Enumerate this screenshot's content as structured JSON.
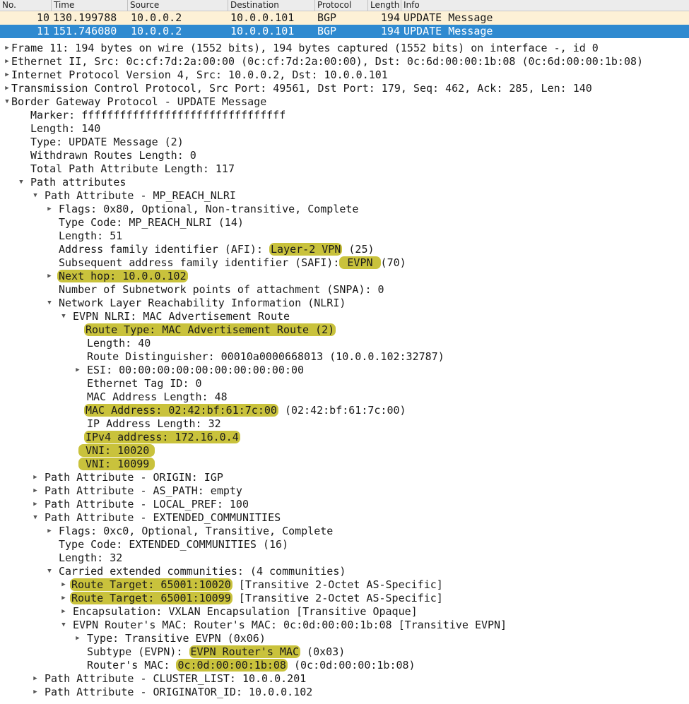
{
  "columns": {
    "no": "No.",
    "time": "Time",
    "source": "Source",
    "destination": "Destination",
    "protocol": "Protocol",
    "length": "Length",
    "info": "Info"
  },
  "packets": [
    {
      "no": "10",
      "time": "130.199788",
      "source": "10.0.0.2",
      "destination": "10.0.0.101",
      "protocol": "BGP",
      "length": "194",
      "info": "UPDATE Message"
    },
    {
      "no": "11",
      "time": "151.746080",
      "source": "10.0.0.2",
      "destination": "10.0.0.101",
      "protocol": "BGP",
      "length": "194",
      "info": "UPDATE Message"
    }
  ],
  "tree": {
    "frame": "Frame 11: 194 bytes on wire (1552 bits), 194 bytes captured (1552 bits) on interface -, id 0",
    "ethernet": "Ethernet II, Src: 0c:cf:7d:2a:00:00 (0c:cf:7d:2a:00:00), Dst: 0c:6d:00:00:1b:08 (0c:6d:00:00:1b:08)",
    "ipv4": "Internet Protocol Version 4, Src: 10.0.0.2, Dst: 10.0.0.101",
    "tcp": "Transmission Control Protocol, Src Port: 49561, Dst Port: 179, Seq: 462, Ack: 285, Len: 140",
    "bgp": "Border Gateway Protocol - UPDATE Message",
    "marker": "Marker: ffffffffffffffffffffffffffffffff",
    "length": "Length: 140",
    "type": "Type: UPDATE Message (2)",
    "withdrawn": "Withdrawn Routes Length: 0",
    "total_pal": "Total Path Attribute Length: 117",
    "path_attrs": "Path attributes",
    "mp_reach": "Path Attribute - MP_REACH_NLRI",
    "mp_flags": "Flags: 0x80, Optional, Non-transitive, Complete",
    "mp_type_code": "Type Code: MP_REACH_NLRI (14)",
    "mp_length": "Length: 51",
    "afi_prefix": "Address family identifier (AFI): ",
    "afi_hl": "Layer-2 VPN",
    "afi_suffix": " (25)",
    "safi_prefix": "Subsequent address family identifier (SAFI):",
    "safi_hl": " EVPN ",
    "safi_suffix": "(70)",
    "next_hop": "Next hop: 10.0.0.102",
    "snpa": "Number of Subnetwork points of attachment (SNPA): 0",
    "nlri": "Network Layer Reachability Information (NLRI)",
    "evpn_nlri": "EVPN NLRI: MAC Advertisement Route",
    "route_type": "Route Type: MAC Advertisement Route (2)",
    "evpn_length": "Length: 40",
    "rd": "Route Distinguisher: 00010a0000668013 (10.0.0.102:32787)",
    "esi": "ESI: 00:00:00:00:00:00:00:00:00:00",
    "eth_tag": "Ethernet Tag ID: 0",
    "mac_len": "MAC Address Length: 48",
    "mac_addr_hl": "MAC Address: 02:42:bf:61:7c:00",
    "mac_addr_suffix": " (02:42:bf:61:7c:00)",
    "ip_len": "IP Address Length: 32",
    "ipv4_addr": "IPv4 address: 172.16.0.4",
    "vni1": "VNI: 10020",
    "vni2": "VNI: 10099",
    "origin": "Path Attribute - ORIGIN: IGP",
    "as_path": "Path Attribute - AS_PATH: empty",
    "local_pref": "Path Attribute - LOCAL_PREF: 100",
    "ext_comm": "Path Attribute - EXTENDED_COMMUNITIES",
    "ec_flags": "Flags: 0xc0, Optional, Transitive, Complete",
    "ec_type_code": "Type Code: EXTENDED_COMMUNITIES (16)",
    "ec_length": "Length: 32",
    "carried": "Carried extended communities: (4 communities)",
    "rt1_hl": "Route Target: 65001:10020",
    "rt1_suffix": " [Transitive 2-Octet AS-Specific]",
    "rt2_hl": "Route Target: 65001:10099",
    "rt2_suffix": " [Transitive 2-Octet AS-Specific]",
    "encap": "Encapsulation: VXLAN Encapsulation [Transitive Opaque]",
    "router_mac_comm": "EVPN Router's MAC: Router's MAC: 0c:0d:00:00:1b:08 [Transitive EVPN]",
    "rm_type": "Type: Transitive EVPN (0x06)",
    "rm_subtype_prefix": "Subtype (EVPN): ",
    "rm_subtype_hl": "EVPN Router's MAC",
    "rm_subtype_suffix": " (0x03)",
    "rm_mac_prefix": "Router's MAC: ",
    "rm_mac_hl": "0c:0d:00:00:1b:08",
    "rm_mac_suffix": " (0c:0d:00:00:1b:08)",
    "cluster": "Path Attribute - CLUSTER_LIST: 10.0.0.201",
    "originator": "Path Attribute - ORIGINATOR_ID: 10.0.0.102"
  }
}
